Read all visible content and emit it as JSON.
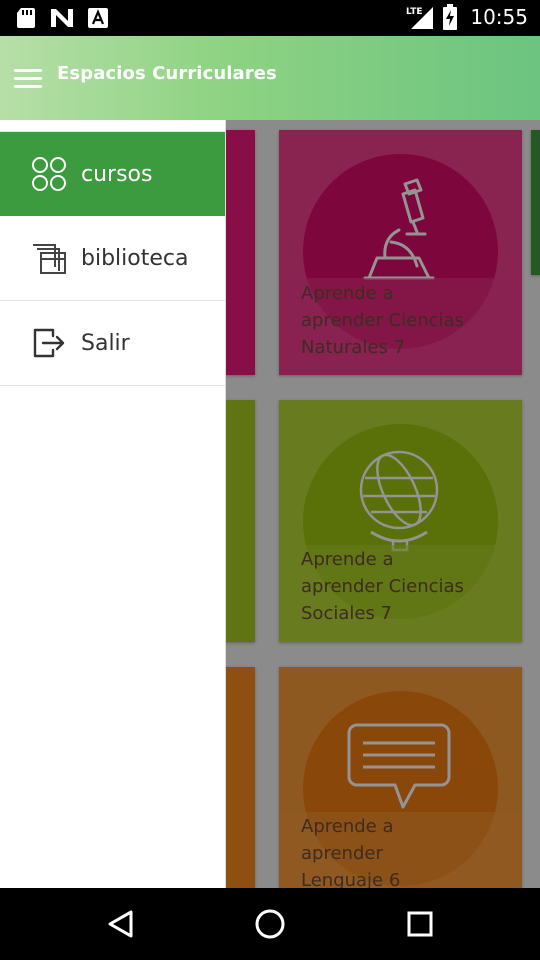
{
  "status_bar": {
    "time": "10:55",
    "network": "LTE",
    "left_icons": [
      "sd-card-icon",
      "n-logo-icon",
      "font-a-icon"
    ],
    "right_icons": [
      "signal-icon",
      "battery-charging-icon"
    ]
  },
  "app_bar": {
    "title": "Espacios Curriculares",
    "menu_icon": "hamburger-menu-icon"
  },
  "drawer": {
    "items": [
      {
        "label": "cursos",
        "icon": "grid-circles-icon",
        "active": true
      },
      {
        "label": "biblioteca",
        "icon": "library-stack-icon",
        "active": false
      },
      {
        "label": "Salir",
        "icon": "exit-icon",
        "active": false
      }
    ]
  },
  "cards": [
    {
      "title": "Aprende a aprender Ciencias Naturales 7",
      "lines": [
        "Aprende a",
        "aprender Ciencias",
        "Naturales 7"
      ],
      "icon": "microscope-icon",
      "color": "#e8197a"
    },
    {
      "title": "Aprende a aprender Ciencias Sociales 7",
      "lines": [
        "Aprende a",
        "aprender Ciencias",
        "Sociales 7"
      ],
      "icon": "globe-icon",
      "color": "#a6c81f"
    },
    {
      "title": "Aprende a aprender Lenguaje 6",
      "lines": [
        "Aprende a",
        "aprender",
        "Lenguaje 6"
      ],
      "icon": "speech-bubble-icon",
      "color": "#f38a1e"
    }
  ],
  "nav_bar": {
    "buttons": [
      "back-icon",
      "home-icon",
      "recents-icon"
    ]
  }
}
